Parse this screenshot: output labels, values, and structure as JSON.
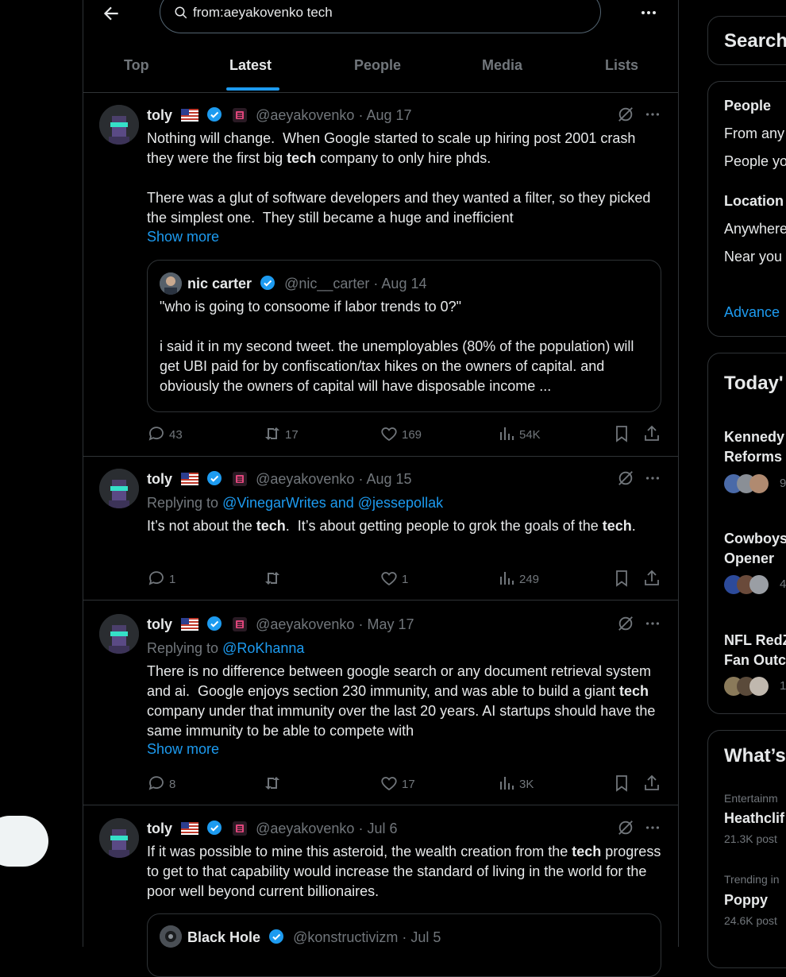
{
  "search": {
    "query": "from:aeyakovenko tech"
  },
  "tabs": [
    "Top",
    "Latest",
    "People",
    "Media",
    "Lists"
  ],
  "tweets": [
    {
      "name": "toly",
      "handle": "@aeyakovenko",
      "time": "· Aug 17",
      "body_parts": [
        "Nothing will change.  When Google started to scale up hiring post 2001 crash they were the first big ",
        "tech",
        " company to only hire phds.\n\nThere was a glut of software developers and they wanted a filter, so they picked the simplest one.  They still became a huge and inefficient"
      ],
      "show_more": "Show more",
      "quote": {
        "name": "nic carter",
        "handle": "@nic__carter",
        "time": "· Aug 14",
        "body": "\"who is going to consoome if labor trends to 0?\"\n\ni said it in my second tweet. the unemployables (80% of the population) will get UBI paid for by confiscation/tax hikes on the owners of capital. and obviously the owners of capital will have disposable income ..."
      },
      "replies": "43",
      "reposts": "17",
      "likes": "169",
      "views": "54K"
    },
    {
      "name": "toly",
      "handle": "@aeyakovenko",
      "time": "· Aug 15",
      "replying_prefix": "Replying to ",
      "replying_to": "@VinegarWrites and @jessepollak",
      "body_parts": [
        "It’s not about the ",
        "tech",
        ".  It’s about getting people to grok the goals of the ",
        "tech",
        "."
      ],
      "replies": "1",
      "reposts": "",
      "likes": "1",
      "views": "249"
    },
    {
      "name": "toly",
      "handle": "@aeyakovenko",
      "time": "· May 17",
      "replying_prefix": "Replying to ",
      "replying_to": "@RoKhanna",
      "body_parts": [
        "There is no difference between google search or any document retrieval system and ai.  Google enjoys section 230 immunity, and was able to build a giant ",
        "tech",
        " company under that immunity over the last 20 years. AI startups should have the same immunity to be able to compete with"
      ],
      "show_more": "Show more",
      "replies": "8",
      "reposts": "",
      "likes": "17",
      "views": "3K"
    },
    {
      "name": "toly",
      "handle": "@aeyakovenko",
      "time": "· Jul 6",
      "body_parts": [
        "If it was possible to mine this asteroid, the wealth creation from the ",
        "tech",
        " progress to get to that capability would increase the standard of living in the world for the poor well beyond current billionaires."
      ],
      "quote": {
        "name": "Black Hole",
        "handle": "@konstructivizm",
        "time": "· Jul 5"
      }
    }
  ],
  "sidebar": {
    "search_title": "Search",
    "filters": {
      "people_title": "People",
      "from_any": "From any",
      "people_you": "People yo",
      "location_title": "Location",
      "anywhere": "Anywhere",
      "near_you": "Near you",
      "advanced": "Advance"
    },
    "today": {
      "title": "Today'",
      "items": [
        {
          "line1": "Kennedy",
          "line2": "Reforms",
          "count": "9"
        },
        {
          "line1": "Cowboys",
          "line2": "Opener",
          "count": "4"
        },
        {
          "line1": "NFL RedZ",
          "line2": "Fan Outc",
          "count": "1"
        }
      ]
    },
    "whats": {
      "title": "What’s",
      "items": [
        {
          "category": "Entertainm",
          "topic": "Heathclif",
          "posts": "21.3K post"
        },
        {
          "category": "Trending in",
          "topic": "Poppy",
          "posts": "24.6K post"
        }
      ]
    }
  },
  "colors": {
    "accent": "#1d9bf0",
    "background": "#000000",
    "text": "#e7e9ea",
    "muted": "#71767b",
    "border": "#2f3336"
  }
}
